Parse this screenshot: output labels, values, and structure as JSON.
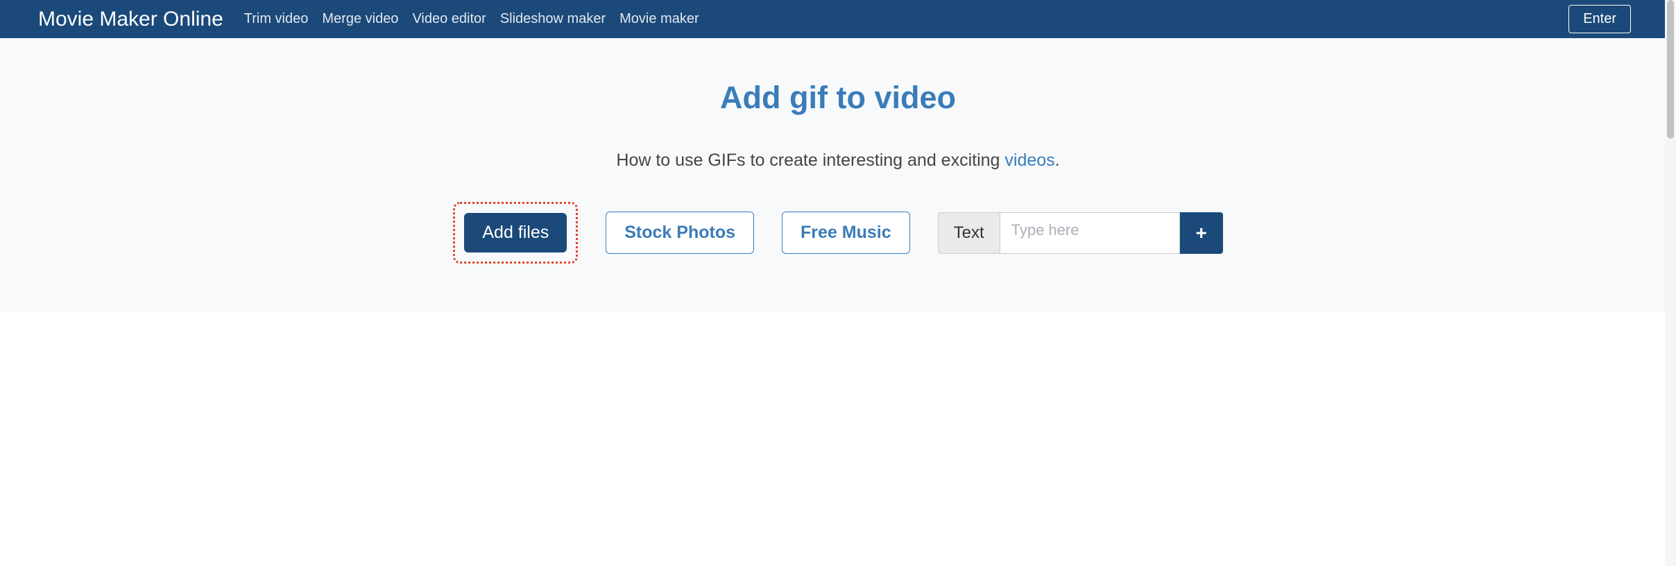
{
  "navbar": {
    "brand": "Movie Maker Online",
    "links": [
      "Trim video",
      "Merge video",
      "Video editor",
      "Slideshow maker",
      "Movie maker"
    ],
    "enter": "Enter"
  },
  "main": {
    "title": "Add gif to video",
    "subtitle_prefix": "How to use GIFs to create interesting and exciting ",
    "subtitle_link": "videos",
    "subtitle_suffix": ".",
    "add_files": "Add files",
    "stock_photos": "Stock Photos",
    "free_music": "Free Music",
    "text_label": "Text",
    "text_placeholder": "Type here",
    "plus": "+"
  }
}
